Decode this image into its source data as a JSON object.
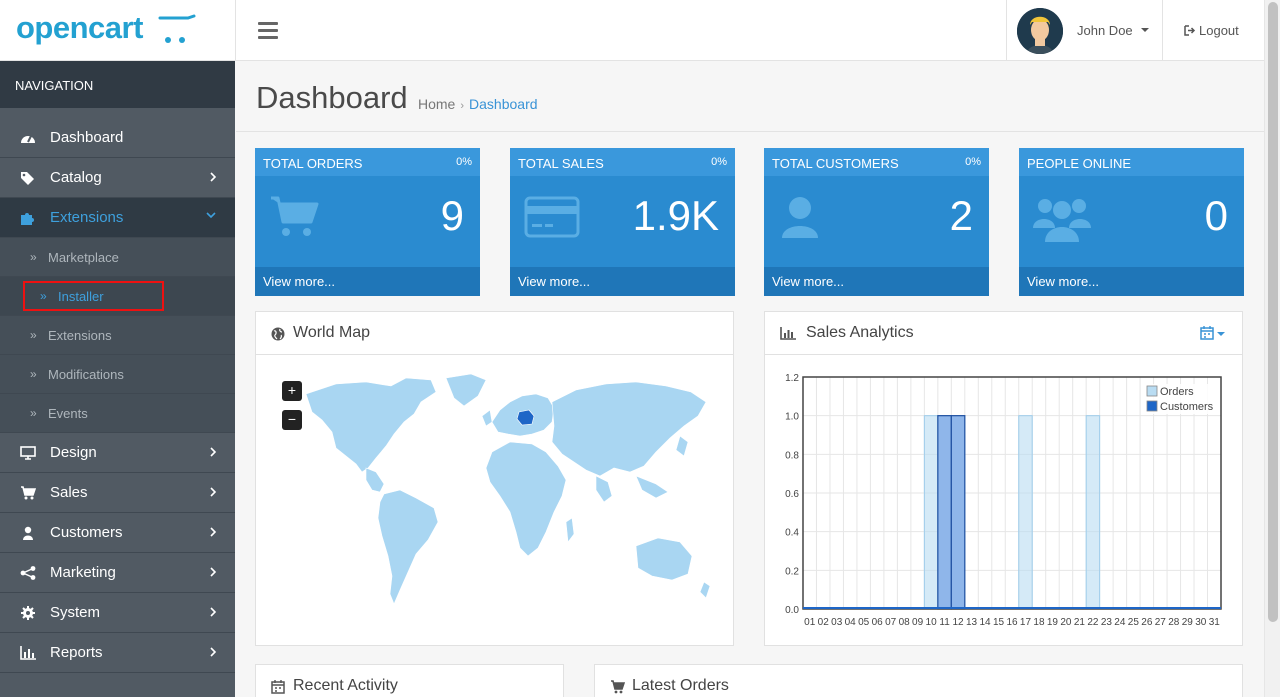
{
  "header": {
    "logo_text": "opencart",
    "user_name": "John Doe",
    "logout_label": "Logout"
  },
  "sidebar": {
    "title": "NAVIGATION",
    "items": [
      {
        "label": "Dashboard",
        "icon": "dashboard-icon"
      },
      {
        "label": "Catalog",
        "icon": "tags-icon"
      },
      {
        "label": "Extensions",
        "icon": "puzzle-icon"
      },
      {
        "label": "Design",
        "icon": "monitor-icon"
      },
      {
        "label": "Sales",
        "icon": "cart-icon"
      },
      {
        "label": "Customers",
        "icon": "user-icon"
      },
      {
        "label": "Marketing",
        "icon": "share-icon"
      },
      {
        "label": "System",
        "icon": "gear-icon"
      },
      {
        "label": "Reports",
        "icon": "bar-chart-icon"
      }
    ],
    "sub_items": [
      "Marketplace",
      "Installer",
      "Extensions",
      "Modifications",
      "Events"
    ]
  },
  "page": {
    "title": "Dashboard",
    "breadcrumb_home": "Home",
    "breadcrumb_current": "Dashboard"
  },
  "tiles": [
    {
      "title": "TOTAL ORDERS",
      "pct": "0%",
      "value": "9",
      "footer": "View more..."
    },
    {
      "title": "TOTAL SALES",
      "pct": "0%",
      "value": "1.9K",
      "footer": "View more..."
    },
    {
      "title": "TOTAL CUSTOMERS",
      "pct": "0%",
      "value": "2",
      "footer": "View more..."
    },
    {
      "title": "PEOPLE ONLINE",
      "pct": "",
      "value": "0",
      "footer": "View more..."
    }
  ],
  "panels": {
    "world_map": "World Map",
    "sales_analytics": "Sales Analytics",
    "recent_activity": "Recent Activity",
    "latest_orders": "Latest Orders"
  },
  "map_controls": {
    "zoom_in": "+",
    "zoom_out": "−"
  },
  "colors": {
    "accent": "#2a8bd0",
    "orders": "#b9dcf2",
    "customers": "#1e66c7"
  },
  "chart_data": {
    "type": "bar",
    "categories": [
      "01",
      "02",
      "03",
      "04",
      "05",
      "06",
      "07",
      "08",
      "09",
      "10",
      "11",
      "12",
      "13",
      "14",
      "15",
      "16",
      "17",
      "18",
      "19",
      "20",
      "21",
      "22",
      "23",
      "24",
      "25",
      "26",
      "27",
      "28",
      "29",
      "30",
      "31"
    ],
    "series": [
      {
        "name": "Orders",
        "values": [
          0,
          0,
          0,
          0,
          0,
          0,
          0,
          0,
          0,
          1,
          1,
          1,
          0,
          0,
          0,
          0,
          1,
          0,
          0,
          0,
          0,
          1,
          0,
          0,
          0,
          0,
          0,
          0,
          0,
          0,
          0
        ]
      },
      {
        "name": "Customers",
        "values": [
          0,
          0,
          0,
          0,
          0,
          0,
          0,
          0,
          0,
          0,
          1,
          1,
          0,
          0,
          0,
          0,
          0,
          0,
          0,
          0,
          0,
          0,
          0,
          0,
          0,
          0,
          0,
          0,
          0,
          0,
          0
        ]
      }
    ],
    "yticks": [
      "0.0",
      "0.2",
      "0.4",
      "0.6",
      "0.8",
      "1.0",
      "1.2"
    ],
    "ylim": [
      0,
      1.2
    ],
    "grid": true,
    "legend": "top-right"
  }
}
